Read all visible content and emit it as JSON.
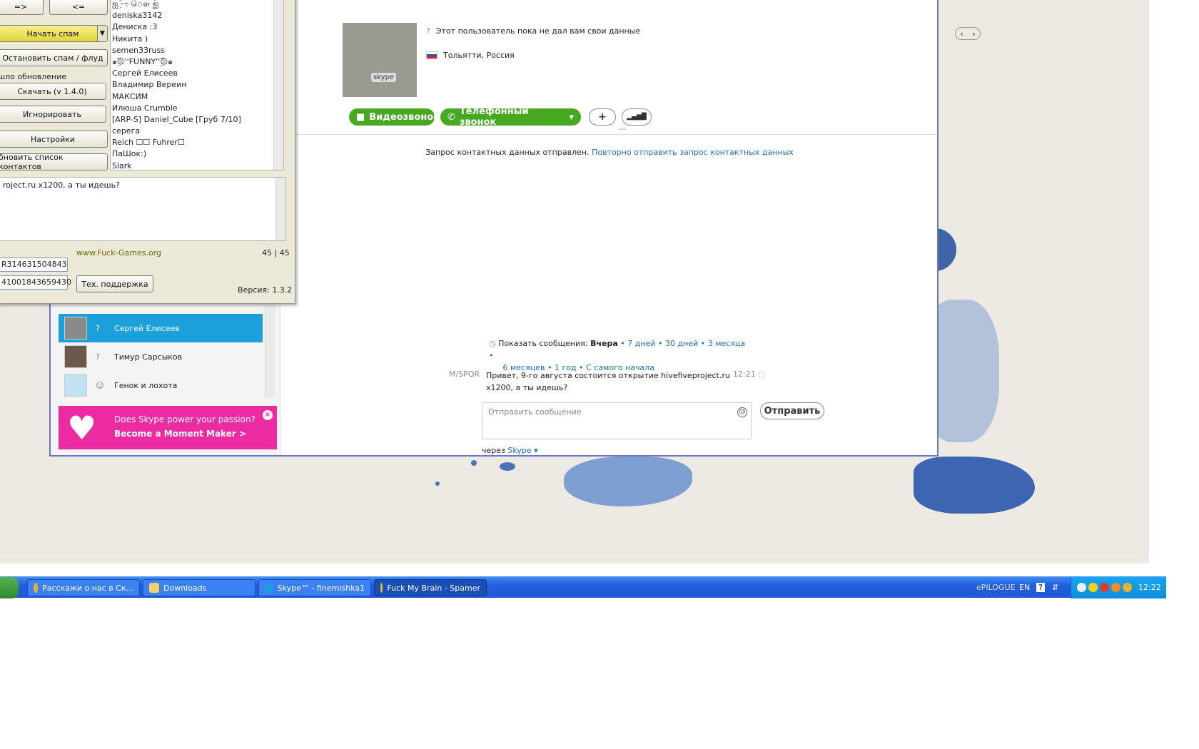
{
  "skype": {
    "contacts": [
      {
        "name": "Сергей Елисеев",
        "selected": true
      },
      {
        "name": "Тимур Сарсыков",
        "selected": false
      },
      {
        "name": "Генок и лохота",
        "selected": false
      }
    ],
    "ad": {
      "line1": "Does Skype power your passion?",
      "line2": "Become a Moment Maker >",
      "close": "×"
    },
    "profile": {
      "status_text": "Этот пользователь пока не дал вам свои данные",
      "location": "Тольятти, Россия",
      "nav_prev": "‹",
      "nav_next": "›",
      "picture_label": "skype"
    },
    "actions": {
      "video_call": "Видеозвонок",
      "phone_call": "Телефонный звонок",
      "dropdown": "▾",
      "add": "+",
      "signal": "▂▄▆█",
      "more": "..."
    },
    "request": {
      "sent_text": "Запрос контактных данных отправлен.",
      "resend_link": "Повторно отправить запрос контактных данных"
    },
    "history": {
      "label": "Показать сообщения:",
      "current": "Вчера",
      "sep": "•",
      "options": [
        "7 дней",
        "30 дней",
        "3 месяца",
        "6 месяцев",
        "1 год",
        "С самого начала"
      ]
    },
    "message": {
      "author": "M/SPQR",
      "text": "Привет, 9-го августа состоится открытие hivefiveproject.ru x1200, а ты идешь?",
      "time": "12:21"
    },
    "input": {
      "placeholder": "Отправить сообщение",
      "send_label": "Отправить",
      "via_label": "через",
      "via_service": "Skype"
    }
  },
  "spamer": {
    "btn_forward": "=>",
    "btn_back": "<=",
    "btn_start": "Начать спам",
    "btn_stop": "Остановить спам / флуд",
    "update_label": "шло обновление",
    "btn_download": "Скачать (v 1.4.0)",
    "btn_ignore": "Игнорировать",
    "btn_settings": "Настройки",
    "btn_refresh": "бновить список контактов",
    "nick_list": [
      "ஐۣۜ ಌ ௌ ۣۜஐ",
      "deniska3142",
      "Дениска :3",
      "Никита )",
      "semen33russ",
      "๑ۣۜۜ۞''FUNNY''ۣۜۜ۞๑",
      "Сергей Елисеев",
      "Владимир Верeин",
      "МАКСИМ",
      "Илюша Crumble",
      "[ARP-S] Daniel_Cube [Груб 7/10]",
      "серега",
      "Reich ☐☐ Fuhrer☐",
      "ПаШок:)",
      "Slark"
    ],
    "message_text": "roject.ru x1200, а ты идешь?",
    "site_link": "www.Fuck-Games.org",
    "count": "45 | 45",
    "field1": "R314631504843",
    "field2": "41001843659430",
    "btn_support": "Тех. поддержка",
    "version": "Версия: 1.3.2"
  },
  "taskbar": {
    "start": "",
    "tasks": [
      {
        "label": "Расскажи о нас в Ск...",
        "icon_color": "#e8b32e",
        "active": false
      },
      {
        "label": "Downloads",
        "icon_color": "#f2d26b",
        "active": false
      },
      {
        "label": "Skype™ - finemishka1",
        "icon_color": "#1ba0dc",
        "active": false
      },
      {
        "label": "Fuck My Brain - Spamer",
        "icon_color": "#e3c21a",
        "active": true
      }
    ],
    "tray": {
      "epilogue": "ePILOGUE",
      "lang": "EN",
      "help": "?",
      "time": "12:22"
    }
  }
}
